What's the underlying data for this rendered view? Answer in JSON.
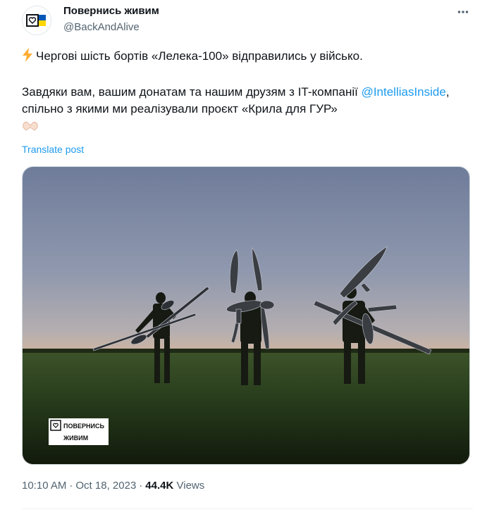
{
  "author": {
    "name": "Повернись живим",
    "handle": "@BackAndAlive"
  },
  "tweet": {
    "line1": "Чергові шість бортів «Лелека-100» відправились у військо.",
    "line2_before": "Завдяки вам, вашим донатам та нашим друзям з IT-компанії ",
    "mention": "@IntelliasInside",
    "line2_after": ", спільно з якими ми реалізували проєкт «Крила для ГУР»",
    "translate_label": "Translate post"
  },
  "media": {
    "logo_line1": "ПОВЕРНИСЬ",
    "logo_line2": "ЖИВИМ"
  },
  "meta": {
    "time": "10:10 AM",
    "separator": "·",
    "date": "Oct 18, 2023",
    "views_count": "44.4K",
    "views_label": "Views"
  },
  "icons": {
    "more": "more-icon",
    "bolt": "lightning-bolt-icon",
    "hands": "heart-hands-icon",
    "avatar": "heart-flag-logo"
  },
  "colors": {
    "link": "#1d9bf0",
    "secondary_text": "#536471",
    "primary_text": "#0f1419",
    "flag_blue": "#0057b7",
    "flag_yellow": "#ffd700"
  }
}
